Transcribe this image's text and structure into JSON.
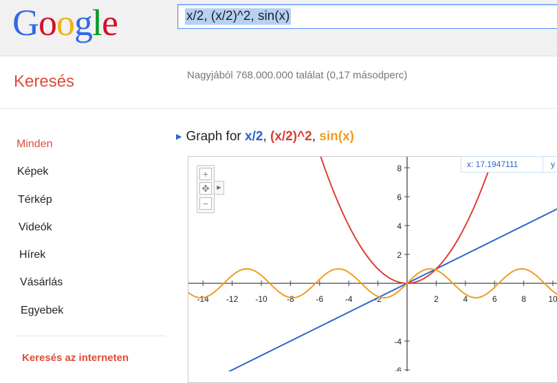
{
  "header": {
    "logo_letters": [
      {
        "char": "G",
        "color": "#3369e8"
      },
      {
        "char": "o",
        "color": "#d50f25"
      },
      {
        "char": "o",
        "color": "#eeb211"
      },
      {
        "char": "g",
        "color": "#3369e8"
      },
      {
        "char": "l",
        "color": "#009925"
      },
      {
        "char": "e",
        "color": "#d50f25"
      }
    ],
    "search_query": "x/2, (x/2)^2, sin(x)"
  },
  "subbar": {
    "title": "Keresés",
    "result_stats": "Nagyjából 768.000.000 találat (0,17 másodperc)"
  },
  "nav": {
    "items": [
      {
        "label": "Minden",
        "active": true
      },
      {
        "label": "Képek",
        "active": false
      },
      {
        "label": "Térkép",
        "active": false
      },
      {
        "label": "Videók",
        "active": false
      },
      {
        "label": "Hírek",
        "active": false
      },
      {
        "label": "Vásárlás",
        "active": false
      },
      {
        "label": "Egyebek",
        "active": false
      }
    ],
    "section_title": "Keresés az interneten"
  },
  "graph": {
    "title_prefix": "Graph for",
    "functions": [
      {
        "label": "x/2",
        "color": "#2b65c9"
      },
      {
        "label": "(x/2)^2",
        "color": "#dd3b32"
      },
      {
        "label": "sin(x)",
        "color": "#f09c1c"
      }
    ],
    "zoom_in_symbol": "+",
    "pan_symbol": "✥",
    "zoom_out_symbol": "−",
    "pan_arrow_symbol": "▶",
    "coord_x": "x: 17.1947111",
    "coord_y": "y"
  },
  "chart_data": {
    "type": "line",
    "title": "",
    "xlabel": "",
    "ylabel": "",
    "xlim": [
      -15,
      11
    ],
    "ylim": [
      -7,
      9
    ],
    "x_ticks": [
      -14,
      -12,
      -10,
      -8,
      -6,
      -4,
      -2,
      2,
      4,
      6,
      8,
      10
    ],
    "y_ticks": [
      8,
      6,
      4,
      2,
      -4,
      -6
    ],
    "series": [
      {
        "name": "x/2",
        "formula": "x/2",
        "color": "#2b65c9"
      },
      {
        "name": "(x/2)^2",
        "formula": "(x/2)^2",
        "color": "#dd3b32"
      },
      {
        "name": "sin(x)",
        "formula": "sin(x)",
        "color": "#f09c1c"
      }
    ],
    "grid": false
  }
}
